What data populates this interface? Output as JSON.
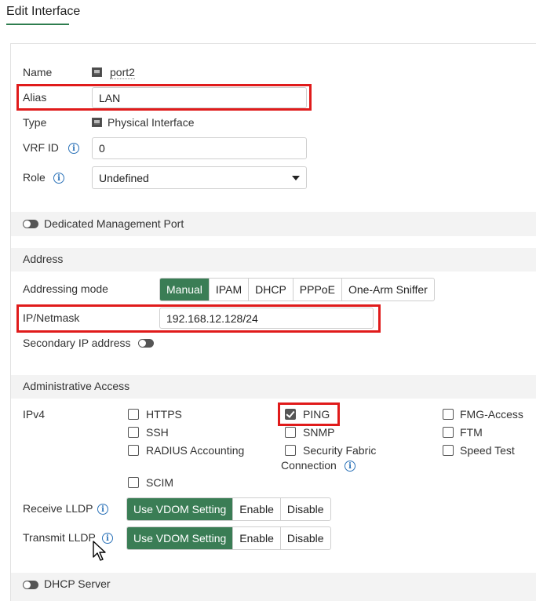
{
  "header": {
    "title": "Edit Interface"
  },
  "general": {
    "name_label": "Name",
    "name_value": "port2",
    "alias_label": "Alias",
    "alias_value": "LAN",
    "type_label": "Type",
    "type_value": "Physical Interface",
    "vrf_label": "VRF ID",
    "vrf_value": "0",
    "role_label": "Role",
    "role_value": "Undefined"
  },
  "dedicated_mgmt": {
    "label": "Dedicated Management Port",
    "enabled": false
  },
  "address": {
    "section_title": "Address",
    "mode_label": "Addressing mode",
    "modes": [
      "Manual",
      "IPAM",
      "DHCP",
      "PPPoE",
      "One-Arm Sniffer"
    ],
    "active_mode": "Manual",
    "ip_label": "IP/Netmask",
    "ip_value": "192.168.12.128/24",
    "secondary_label": "Secondary IP address",
    "secondary_enabled": false
  },
  "admin_access": {
    "section_title": "Administrative Access",
    "ipv4_label": "IPv4",
    "options": {
      "https": {
        "label": "HTTPS",
        "checked": false
      },
      "ping": {
        "label": "PING",
        "checked": true
      },
      "fmg": {
        "label": "FMG-Access",
        "checked": false
      },
      "ssh": {
        "label": "SSH",
        "checked": false
      },
      "snmp": {
        "label": "SNMP",
        "checked": false
      },
      "ftm": {
        "label": "FTM",
        "checked": false
      },
      "radius": {
        "label": "RADIUS Accounting",
        "checked": false
      },
      "fabric_line1": {
        "label": "Security Fabric",
        "checked": false
      },
      "fabric_line2": {
        "label": "Connection"
      },
      "speed": {
        "label": "Speed Test",
        "checked": false
      },
      "scim": {
        "label": "SCIM",
        "checked": false
      }
    },
    "receive_lldp_label": "Receive LLDP",
    "transmit_lldp_label": "Transmit LLDP",
    "lldp_options": [
      "Use VDOM Setting",
      "Enable",
      "Disable"
    ],
    "lldp_receive_active": "Use VDOM Setting",
    "lldp_transmit_active": "Use VDOM Setting"
  },
  "dhcp_server": {
    "label": "DHCP Server",
    "enabled": false
  },
  "colors": {
    "accent_green": "#3a7d55",
    "highlight_red": "#e01b1b",
    "info_blue": "#2b72b8"
  }
}
